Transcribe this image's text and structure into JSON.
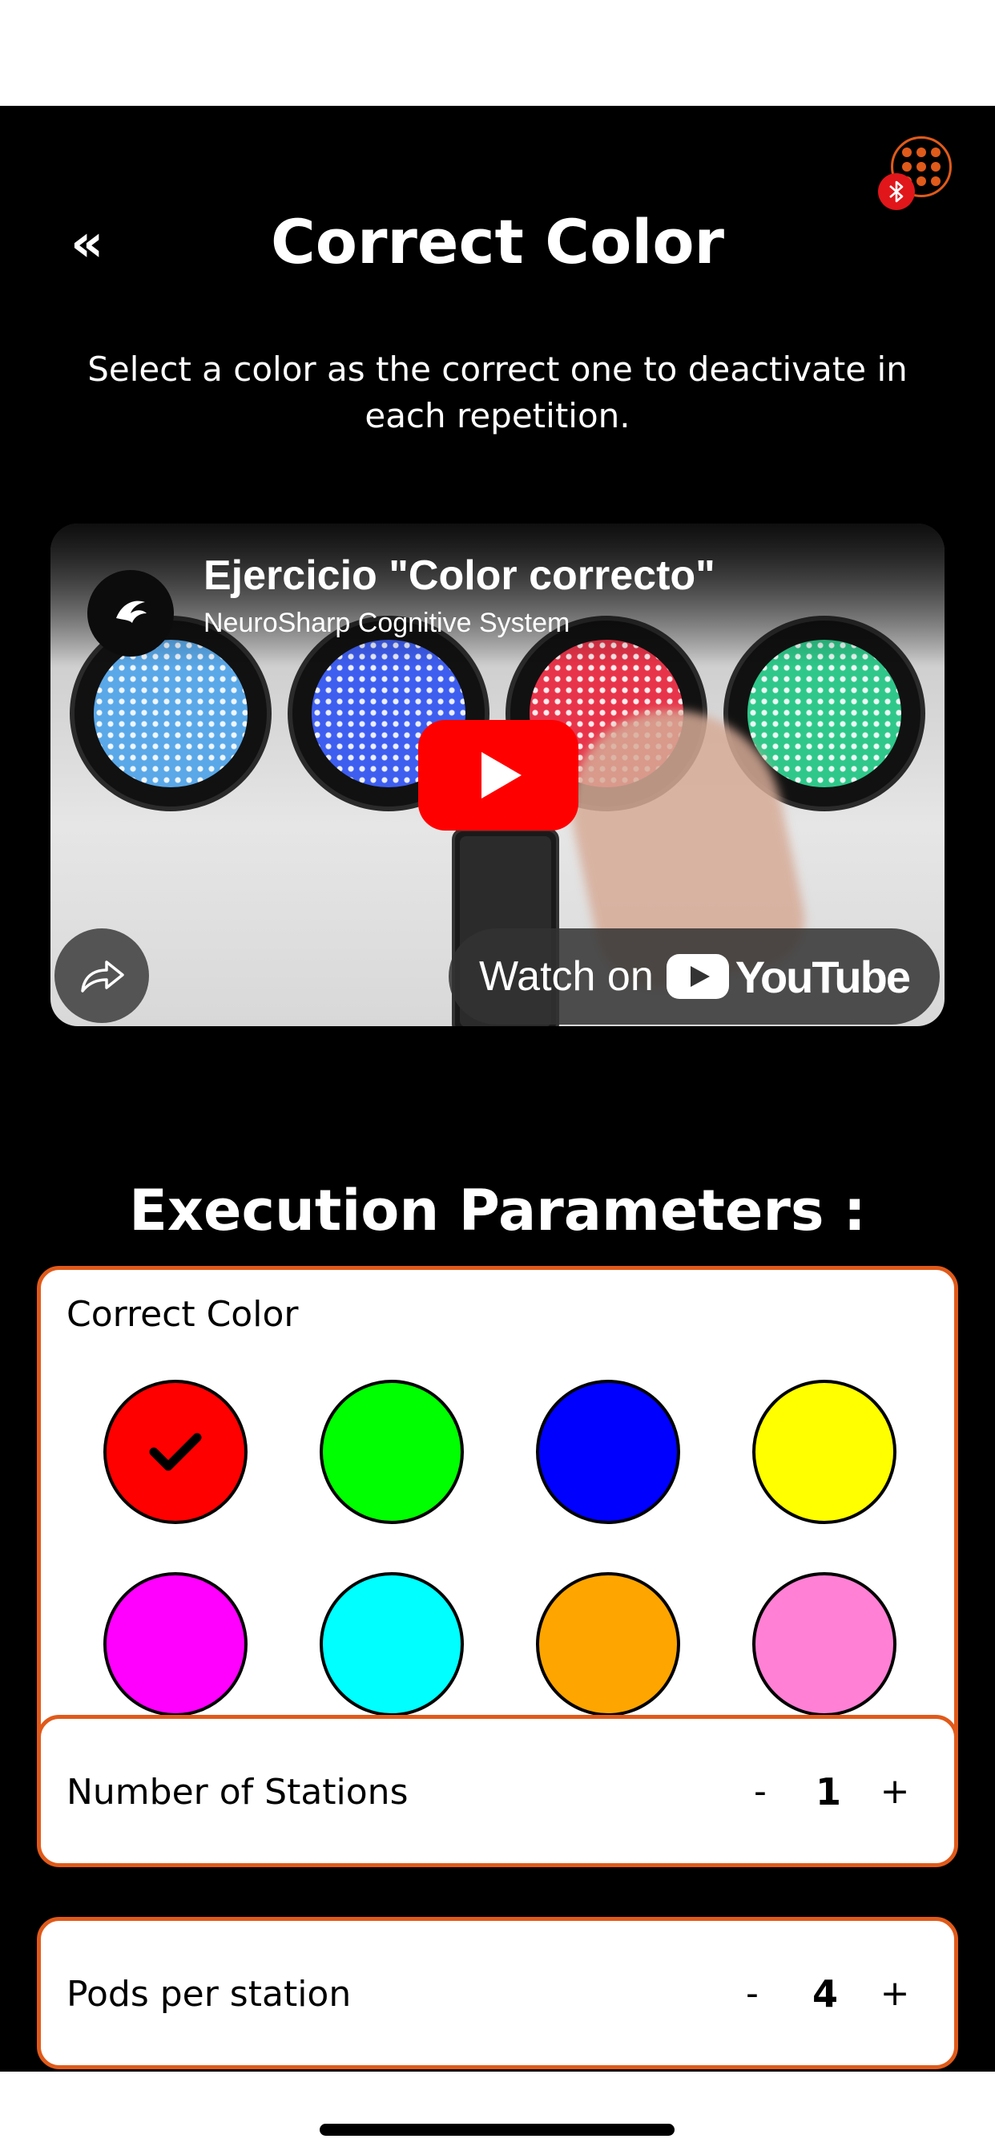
{
  "header": {
    "back_label": "«",
    "title": "Correct Color",
    "menu_icon": "grid-dots-icon",
    "bluetooth_icon": "bluetooth-icon"
  },
  "description": "Select a color as the correct one to deactivate in each repetition.",
  "video": {
    "title": "Ejercicio \"Color correcto\"",
    "channel": "NeuroSharp Cognitive System",
    "watch_on": "Watch on",
    "platform": "YouTube"
  },
  "section_title": "Execution Parameters :",
  "correct_color": {
    "label": "Correct Color",
    "selected_index": 0,
    "options": [
      "#ff0000",
      "#00ff00",
      "#0000ff",
      "#ffff00",
      "#ff00ff",
      "#00ffff",
      "#ffa500",
      "#ff80d5"
    ]
  },
  "stations": {
    "label": "Number of Stations",
    "minus": "-",
    "value": "1",
    "plus": "+"
  },
  "pods": {
    "label": "Pods per station",
    "minus": "-",
    "value": "4",
    "plus": "+"
  },
  "colors": {
    "accent": "#e05a1a",
    "background": "#000000"
  }
}
